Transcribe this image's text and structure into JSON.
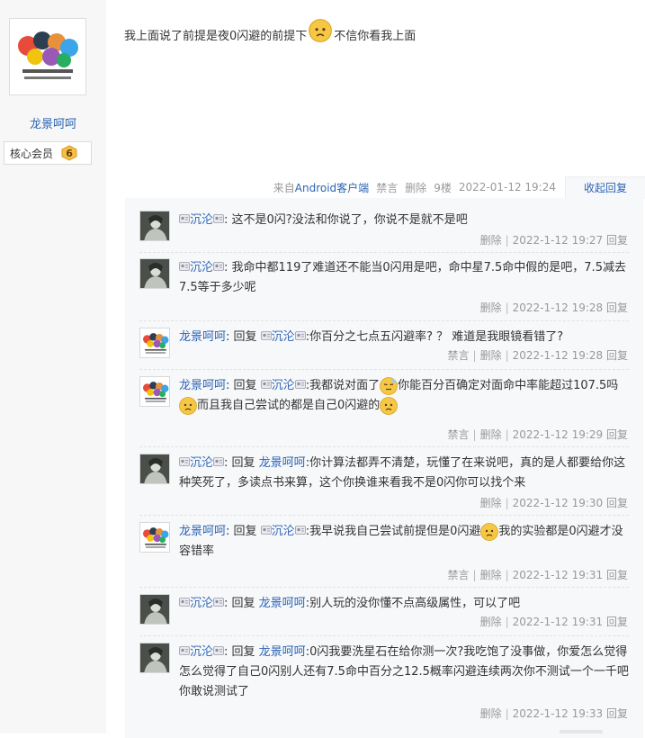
{
  "sidebar": {
    "username": "龙景呵呵",
    "member_label": "核心会员",
    "level": "6"
  },
  "post": {
    "text_part1": "我上面说了前提是夜0闪避的前提下",
    "text_part2": "不信你看我上面",
    "meta": {
      "source_prefix": "来自",
      "source_link": "Android客户端",
      "ban": "禁言",
      "delete": "删除",
      "floor": "9楼",
      "datetime": "2022-01-12 19:24",
      "collapse": "收起回复"
    }
  },
  "replies": [
    {
      "user": "沉沦",
      "content": ": 这不是0闪?没法和你说了，你说不是就不是吧",
      "actions": [
        "删除"
      ],
      "time": "2022-1-12 19:27",
      "reply_label": "回复"
    },
    {
      "user": "沉沦",
      "content": ": 我命中都119了难道还不能当0闪用是吧，命中星7.5命中假的是吧，7.5减去7.5等于多少呢",
      "actions": [
        "删除"
      ],
      "time": "2022-1-12 19:28",
      "reply_label": "回复"
    },
    {
      "user": "龙景呵呵",
      "reply_word": "回复",
      "target": "沉沦",
      "content": ":你百分之七点五闪避率? ？ 难道是我眼镜看错了?",
      "actions": [
        "禁言",
        "删除"
      ],
      "time": "2022-1-12 19:28",
      "reply_label": "回复"
    },
    {
      "user": "龙景呵呵",
      "reply_word": "回复",
      "target": "沉沦",
      "content_a": ":我都说对面了",
      "content_b": "你能百分百确定对面命中率能超过107.5吗",
      "content_c": "而且我自己尝试的都是自己0闪避的",
      "actions": [
        "禁言",
        "删除"
      ],
      "time": "2022-1-12 19:29",
      "reply_label": "回复"
    },
    {
      "user": "沉沦",
      "reply_word": "回复",
      "target": "龙景呵呵",
      "content": ":你计算法都弄不清楚，玩懂了在来说吧，真的是人都要给你这种笑死了，多读点书来算，这个你换谁来看我不是0闪你可以找个来",
      "actions": [
        "删除"
      ],
      "time": "2022-1-12 19:30",
      "reply_label": "回复"
    },
    {
      "user": "龙景呵呵",
      "reply_word": "回复",
      "target": "沉沦",
      "content_a": ":我早说我自己尝试前提但是0闪避",
      "content_b": "我的实验都是0闪避才没容错率",
      "actions": [
        "禁言",
        "删除"
      ],
      "time": "2022-1-12 19:31",
      "reply_label": "回复"
    },
    {
      "user": "沉沦",
      "reply_word": "回复",
      "target": "龙景呵呵",
      "content": ":别人玩的没你懂不点高级属性，可以了吧",
      "actions": [
        "删除"
      ],
      "time": "2022-1-12 19:31",
      "reply_label": "回复"
    },
    {
      "user": "沉沦",
      "reply_word": "回复",
      "target": "龙景呵呵",
      "content": ":0闪我要洗星石在给你测一次?我吃饱了没事做，你爱怎么觉得怎么觉得了自己0闪别人还有7.5命中百分之12.5概率闪避连续两次你不测试一个一千吧你敢说测试了",
      "actions": [
        "删除"
      ],
      "time": "2022-1-12 19:33",
      "reply_label": "回复"
    }
  ],
  "colors": {
    "link": "#2d64b3",
    "meta_gray": "#999999",
    "reply_bg": "#f7f8fa",
    "sidebar_bg": "#f7f7f7"
  },
  "icons": [
    "group-avatar-icon",
    "dark-figure-avatar-icon",
    "frown-emoji-icon",
    "awkward-emoji-icon",
    "level-badge-icon",
    "identity-badge-icon"
  ]
}
